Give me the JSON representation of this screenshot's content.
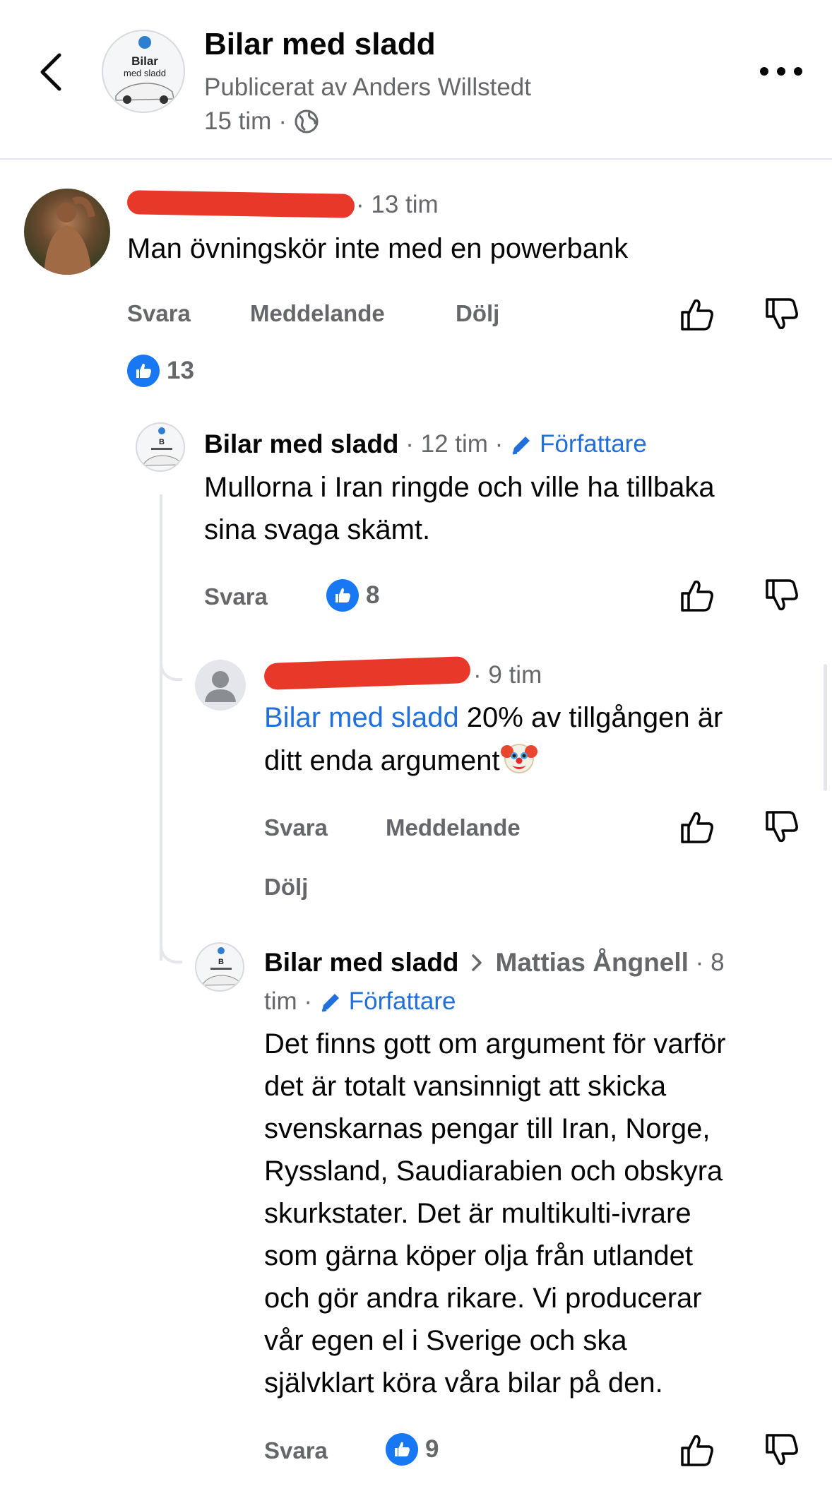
{
  "header": {
    "title": "Bilar med sladd",
    "subtitle": "Publicerat av Anders Willstedt",
    "time": "15 tim",
    "dot": "·",
    "avatar_text_top": "Bilar",
    "avatar_text_bottom": "med sladd"
  },
  "comments": [
    {
      "time": "13 tim",
      "text": "Man övningskör inte med en powerbank",
      "actions": [
        "Svara",
        "Meddelande",
        "Dölj"
      ],
      "likes": "13"
    },
    {
      "author": "Bilar med sladd",
      "time": "12 tim",
      "badge": "Författare",
      "lines": [
        "Mullorna i Iran ringde och ville ha tillbaka",
        "sina svaga skämt."
      ],
      "actions": [
        "Svara"
      ],
      "likes": "8"
    },
    {
      "time": "9 tim",
      "mention": "Bilar med sladd",
      "line1_rest": " 20% av tillgången är",
      "line2": "ditt enda argument",
      "actions": [
        "Svara",
        "Meddelande",
        "Dölj"
      ]
    },
    {
      "author": "Bilar med sladd",
      "reply_to": "Mattias Ångnell",
      "time_part1": "8",
      "time_part2": "tim",
      "badge": "Författare",
      "lines": [
        "Det finns gott om argument för varför",
        "det är totalt vansinnigt att skicka",
        "svenskarnas pengar till Iran, Norge,",
        "Ryssland, Saudiarabien och obskyra",
        "skurkstater. Det är multikulti-ivrare",
        "som gärna köper olja från utlandet",
        "och gör andra rikare. Vi producerar",
        "vår egen el i Sverige och ska",
        "självklart köra våra bilar på den."
      ],
      "actions": [
        "Svara"
      ],
      "likes": "9"
    }
  ],
  "colors": {
    "accent_blue": "#216fdb",
    "like_blue": "#1877f2",
    "redaction_red": "#e8382a",
    "secondary_text": "#65676b"
  },
  "icons": [
    "back-arrow-icon",
    "more-dots-icon",
    "globe-icon",
    "thumbs-up-icon",
    "thumbs-down-icon",
    "pencil-icon",
    "chevron-right-icon",
    "clown-emoji-icon"
  ]
}
